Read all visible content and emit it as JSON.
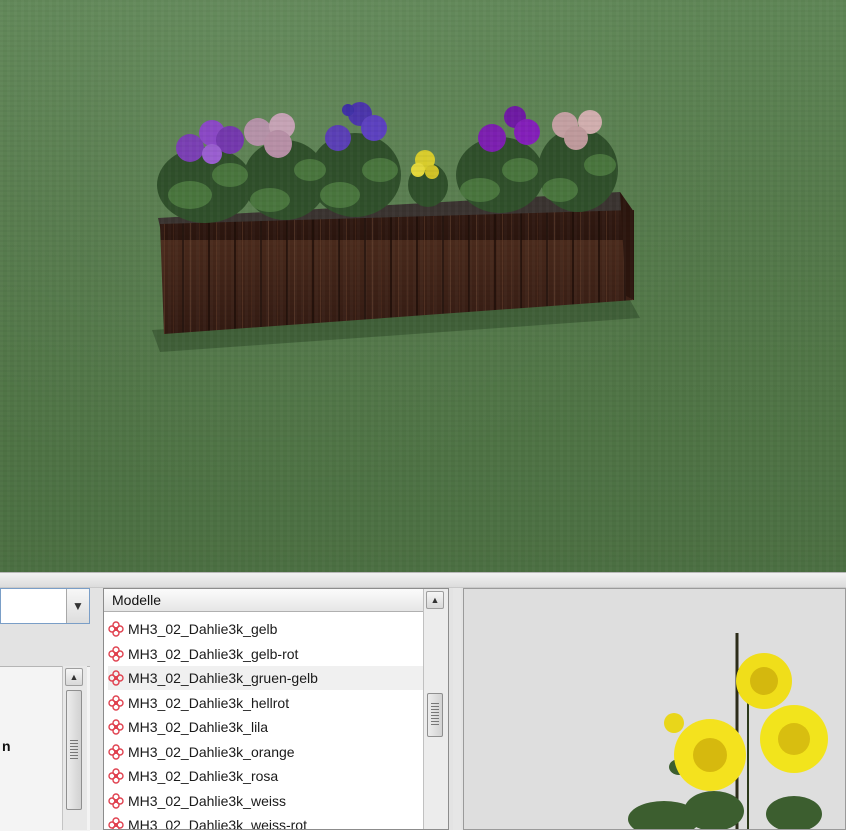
{
  "viewport": {
    "scene": "flower box with pansies on grass"
  },
  "left_panel": {
    "combo_value": "",
    "dropdown_icon": "chevron-down-icon",
    "partial_text": "n"
  },
  "models_list": {
    "header": "Modelle",
    "item_icon": "flower-icon",
    "items": [
      "MH3_02_Dahlie3k_gelb",
      "MH3_02_Dahlie3k_gelb-rot",
      "MH3_02_Dahlie3k_gruen-gelb",
      "MH3_02_Dahlie3k_hellrot",
      "MH3_02_Dahlie3k_lila",
      "MH3_02_Dahlie3k_orange",
      "MH3_02_Dahlie3k_rosa",
      "MH3_02_Dahlie3k_weiss",
      "MH3_02_Dahlie3k_weiss-rot"
    ],
    "selected_index": 2
  },
  "preview": {
    "subject": "yellow dahlia"
  },
  "colors": {
    "grass": "#557a4b",
    "selection": "#f0f0f0",
    "icon_red": "#e0414f"
  }
}
